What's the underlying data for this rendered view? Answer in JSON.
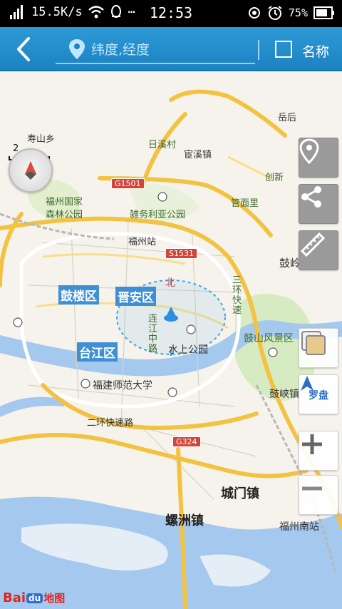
{
  "status_bar": {
    "speed": "15.5K/s",
    "time": "12:53",
    "battery": "75%"
  },
  "header": {
    "search_placeholder": "纬度,经度",
    "name_label": "名称"
  },
  "map": {
    "scale_label": "2公里",
    "districts": {
      "gulou": "鼓楼区",
      "jinan": "晋安区",
      "taijiang": "台江区"
    },
    "places": {
      "shoushan": "寿山乡",
      "yuehou": "岳后",
      "rixi": "日溪村",
      "huanxi": "宦溪镇",
      "chuangxin": "创新",
      "guanmian": "管面里",
      "gudong": "鼓岭",
      "forest_park": [
        "福州国家",
        "森林公园"
      ],
      "weiduo_park": "雑务利亚公园",
      "fuzhou_station": "福州站",
      "north": "北",
      "jinjiang_road": [
        "连",
        "江",
        "中",
        "路"
      ],
      "water_park": "水上公园",
      "gushan": "鼓山风景区",
      "normal_univ": "福建师范大学",
      "ring_road": "二环快速路",
      "kuai_express": [
        "三",
        "环",
        "快",
        "速"
      ],
      "gushan_town": "鼓峡镇",
      "chengmen": "城门镇",
      "luozhou": "螺洲镇",
      "south_station": "福州南站",
      "guhe": "鼓岭"
    },
    "road_shields": {
      "g1501": "G1501",
      "s1531": "S1531",
      "g324": "G324"
    }
  },
  "controls": {
    "compass_label": "罗盘"
  },
  "branding": {
    "bai": "Bai",
    "du": "du",
    "ditu": "地图"
  },
  "colors": {
    "header": "#2d9ad6",
    "river": "#9fc4ea",
    "park": "#cfe7b8",
    "major_road": "#f6c542",
    "district_label": "#3f8fd4"
  }
}
